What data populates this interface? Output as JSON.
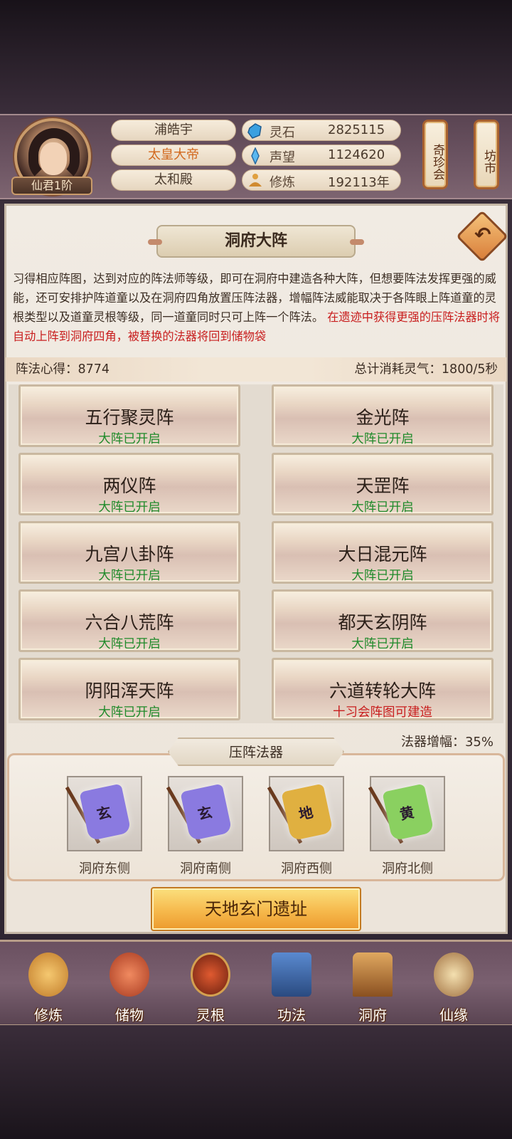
{
  "header": {
    "player_name": "浦皓宇",
    "title": "太皇大帝",
    "location": "太和殿",
    "rank": "仙君1阶",
    "stats": [
      {
        "icon": "spirit-stone-icon",
        "label": "灵石",
        "value": "2825115"
      },
      {
        "icon": "reputation-crystal-icon",
        "label": "声望",
        "value": "1124620"
      },
      {
        "icon": "meditation-icon",
        "label": "修炼",
        "value": "192113年"
      }
    ],
    "shortcuts": [
      "奇珍会",
      "坊市"
    ]
  },
  "page": {
    "title": "洞府大阵",
    "description": "习得相应阵图，达到对应的阵法师等级，即可在洞府中建造各种大阵，但想要阵法发挥更强的威能，还可安排护阵道童以及在洞府四角放置压阵法器，增幅阵法威能取决于各阵眼上阵道童的灵根类型以及道童灵根等级，同一道童同时只可上阵一个阵法。",
    "warning": "在遗迹中获得更强的压阵法器时将自动上阵到洞府四角，被替换的法器将回到储物袋",
    "insight_label": "阵法心得：8774",
    "consumption_label": "总计消耗灵气：1800/5秒"
  },
  "formations": [
    {
      "name": "五行聚灵阵",
      "status": "大阵已开启",
      "state": "open"
    },
    {
      "name": "金光阵",
      "status": "大阵已开启",
      "state": "open"
    },
    {
      "name": "两仪阵",
      "status": "大阵已开启",
      "state": "open"
    },
    {
      "name": "天罡阵",
      "status": "大阵已开启",
      "state": "open"
    },
    {
      "name": "九宫八卦阵",
      "status": "大阵已开启",
      "state": "open"
    },
    {
      "name": "大日混元阵",
      "status": "大阵已开启",
      "state": "open"
    },
    {
      "name": "六合八荒阵",
      "status": "大阵已开启",
      "state": "open"
    },
    {
      "name": "都天玄阴阵",
      "status": "大阵已开启",
      "state": "open"
    },
    {
      "name": "阴阳浑天阵",
      "status": "大阵已开启",
      "state": "open"
    },
    {
      "name": "六道转轮大阵",
      "status": "十习会阵图可建造",
      "state": "locked"
    }
  ],
  "artifacts": {
    "title": "压阵法器",
    "bonus": "法器增幅：35%",
    "slots": [
      {
        "label": "洞府东侧",
        "glyph": "玄",
        "color": "#8a7ae0"
      },
      {
        "label": "洞府南侧",
        "glyph": "玄",
        "color": "#8a7ae0"
      },
      {
        "label": "洞府西侧",
        "glyph": "地",
        "color": "#e0b040"
      },
      {
        "label": "洞府北侧",
        "glyph": "黄",
        "color": "#8ad060"
      }
    ],
    "action": "天地玄门遗址"
  },
  "nav": [
    {
      "label": "修炼",
      "icon": "cultivate-icon",
      "color": "#e0a040"
    },
    {
      "label": "储物",
      "icon": "storage-bag-icon",
      "color": "#d06040"
    },
    {
      "label": "灵根",
      "icon": "spirit-root-icon",
      "color": "#c04020"
    },
    {
      "label": "功法",
      "icon": "technique-book-icon",
      "color": "#3a6ab0"
    },
    {
      "label": "洞府",
      "icon": "cave-dwelling-icon",
      "color": "#c08040"
    },
    {
      "label": "仙缘",
      "icon": "immortal-fate-icon",
      "color": "#e0c080"
    }
  ]
}
